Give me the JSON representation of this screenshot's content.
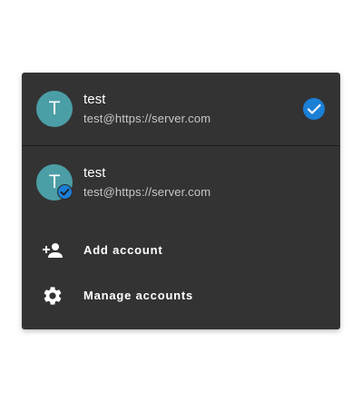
{
  "menu": {
    "current_account": {
      "avatar_letter": "T",
      "name": "test",
      "email": "test@https://server.com",
      "selected_icon": "check-circle-icon"
    },
    "other_account": {
      "avatar_letter": "T",
      "name": "test",
      "email": "test@https://server.com",
      "badge_icon": "check-badge-icon"
    },
    "actions": [
      {
        "label": "Add account",
        "icon": "person-add-icon"
      },
      {
        "label": "Manage accounts",
        "icon": "gear-icon"
      }
    ]
  },
  "colors": {
    "menu_bg": "#333333",
    "avatar_bg": "#4b9ea6",
    "accent_blue": "#1b7fd6",
    "secondary_text": "#c8c8c8"
  }
}
